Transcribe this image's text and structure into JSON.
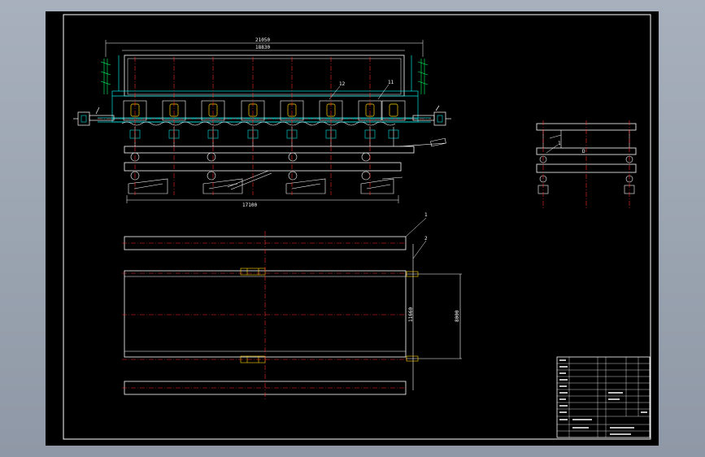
{
  "drawing": {
    "colors": {
      "background": "#000000",
      "border": "#ffffff",
      "outline": "#ffffff",
      "cyan": "#00e5e5",
      "centerline": "#ff2a2a",
      "yellow": "#ffd400",
      "green": "#00ff66"
    }
  },
  "dimensions": {
    "overall_top": "21050",
    "inner_top": "18830",
    "base_bottom": "17100",
    "side_height": "11660",
    "rail_spacing": "8000"
  },
  "leaders": {
    "front_12": "12",
    "front_11": "11",
    "side_1": "1",
    "side_d": "D",
    "plan_1": "1",
    "plan_2": "2"
  }
}
